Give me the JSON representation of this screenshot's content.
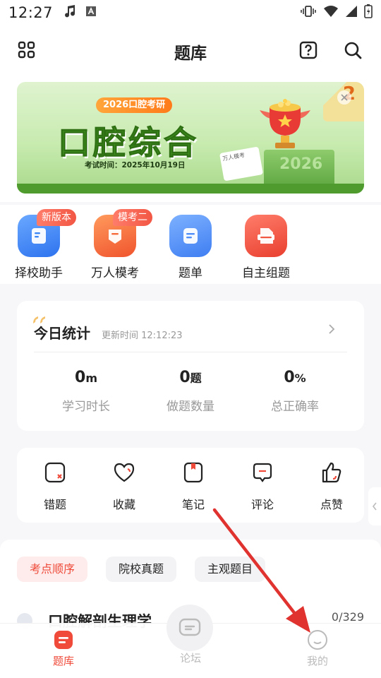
{
  "status_bar": {
    "time": "12:27"
  },
  "header": {
    "title": "题库"
  },
  "banner": {
    "tag": "2026口腔考研",
    "headline": "口腔综合",
    "exam_date": "考试时间：2025年10月19日",
    "corner_number": "2",
    "podium_year": "2026",
    "paper_text": "万人模考",
    "colors": {
      "green": "#3f8f1f",
      "orange": "#ff7a1a"
    }
  },
  "quick_entries": [
    {
      "label": "择校助手",
      "badge": "新版本",
      "icon": "document-icon",
      "color": "#3d86f5"
    },
    {
      "label": "万人模考",
      "badge": "模考二",
      "icon": "exam-icon",
      "color": "#f66a3a"
    },
    {
      "label": "题单",
      "badge": "",
      "icon": "list-icon",
      "color": "#4f8df8"
    },
    {
      "label": "自主组题",
      "badge": "",
      "icon": "paper-icon",
      "color": "#f2553f"
    }
  ],
  "today_stats": {
    "title": "今日统计",
    "updated": "更新时间 12:12:23",
    "items": [
      {
        "value": "0",
        "unit": "m",
        "label": "学习时长"
      },
      {
        "value": "0",
        "unit": "题",
        "label": "做题数量"
      },
      {
        "value": "0",
        "unit": "%",
        "label": "总正确率"
      }
    ]
  },
  "actions": [
    {
      "label": "错题",
      "icon": "wrong-icon"
    },
    {
      "label": "收藏",
      "icon": "heart-icon"
    },
    {
      "label": "笔记",
      "icon": "note-icon"
    },
    {
      "label": "评论",
      "icon": "comment-icon"
    },
    {
      "label": "点赞",
      "icon": "like-icon"
    }
  ],
  "filters": [
    {
      "label": "考点顺序",
      "active": true
    },
    {
      "label": "院校真题",
      "active": false
    },
    {
      "label": "主观题目",
      "active": false
    }
  ],
  "list": [
    {
      "title": "口腔解剖生理学",
      "count": "0/329"
    }
  ],
  "bottom_nav": [
    {
      "label": "题库",
      "active": true,
      "icon": "question-bank-icon"
    },
    {
      "label": "论坛",
      "active": false,
      "icon": "forum-icon"
    },
    {
      "label": "我的",
      "active": false,
      "icon": "profile-icon"
    }
  ],
  "accent_color": "#ef4a3a"
}
